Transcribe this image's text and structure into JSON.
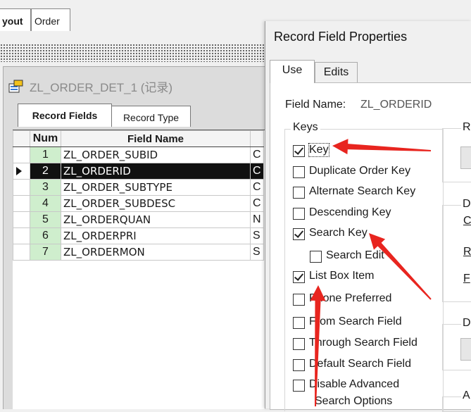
{
  "top_tabs": [
    "yout",
    "Order"
  ],
  "record_window": {
    "title": "ZL_ORDER_DET_1 (记录)",
    "tabs": [
      "Record Fields",
      "Record Type"
    ],
    "columns": [
      "Num",
      "Field Name"
    ],
    "rows": [
      {
        "num": "1",
        "name": "ZL_ORDER_SUBID",
        "type": "C"
      },
      {
        "num": "2",
        "name": "ZL_ORDERID",
        "type": "C"
      },
      {
        "num": "3",
        "name": "ZL_ORDER_SUBTYPE",
        "type": "C"
      },
      {
        "num": "4",
        "name": "ZL_ORDER_SUBDESC",
        "type": "C"
      },
      {
        "num": "5",
        "name": "ZL_ORDERQUAN",
        "type": "N"
      },
      {
        "num": "6",
        "name": "ZL_ORDERPRI",
        "type": "S"
      },
      {
        "num": "7",
        "name": "ZL_ORDERMON",
        "type": "S"
      }
    ],
    "selected_row": "2"
  },
  "dialog": {
    "title": "Record Field Properties",
    "tabs": [
      "Use",
      "Edits"
    ],
    "field_name_label": "Field Name:",
    "field_name_value": "ZL_ORDERID",
    "keys_group_label": "Keys",
    "checkboxes": [
      {
        "label": "Key",
        "checked": true
      },
      {
        "label": "Duplicate Order Key",
        "checked": false
      },
      {
        "label": "Alternate Search Key",
        "checked": false
      },
      {
        "label": "Descending Key",
        "checked": false
      },
      {
        "label": "Search Key",
        "checked": true
      },
      {
        "label": "Search Edit",
        "checked": false
      },
      {
        "label": "List Box Item",
        "checked": true
      },
      {
        "label": "Phone Preferred",
        "checked": false
      },
      {
        "label": "From Search Field",
        "checked": false
      },
      {
        "label": "Through Search Field",
        "checked": false
      },
      {
        "label": "Default Search Field",
        "checked": false
      },
      {
        "label": "Disable Advanced",
        "checked": false
      }
    ],
    "disable_advanced_line2": "Search Options",
    "right_partial": {
      "r_group": "R",
      "d_group": "D",
      "c_label": "C",
      "r_label": "R",
      "f_label": "F",
      "d2_group": "D",
      "a_group": "A"
    }
  },
  "annotation_color": "#e8251f"
}
